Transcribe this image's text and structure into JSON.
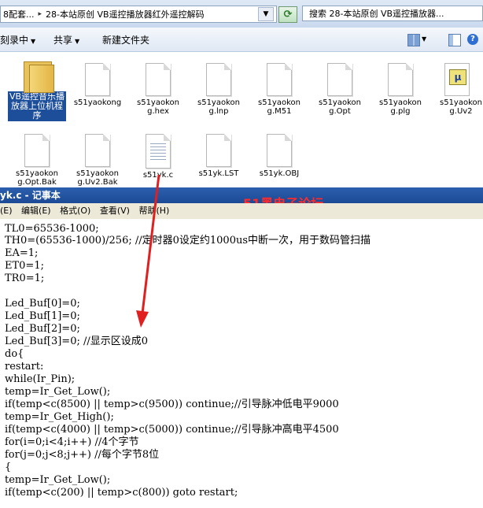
{
  "address_bar": {
    "crumbs": [
      "8配套...",
      "28-本站原创 VB遥控播放器红外遥控解码"
    ],
    "dropdown_icon": "chevron-down-icon",
    "refresh_icon": "refresh-icon",
    "search_text": "搜索 28-本站原创 VB遥控播放器..."
  },
  "toolbar": {
    "items": [
      "刻录中",
      "共享",
      "新建文件夹"
    ]
  },
  "files": [
    {
      "name": "VB遥控音乐播放器上位机程序",
      "type": "folder",
      "selected": true
    },
    {
      "name": "s51yaokong",
      "type": "file"
    },
    {
      "name": "s51yaokong.hex",
      "type": "file"
    },
    {
      "name": "s51yaokong.lnp",
      "type": "file"
    },
    {
      "name": "s51yaokong.M51",
      "type": "file"
    },
    {
      "name": "s51yaokong.Opt",
      "type": "file"
    },
    {
      "name": "s51yaokong.plg",
      "type": "file"
    },
    {
      "name": "s51yaokong.Uv2",
      "type": "uv2"
    },
    {
      "name": "s51yaokong.Opt.Bak",
      "type": "file"
    },
    {
      "name": "s51yaokong.Uv2.Bak",
      "type": "file"
    },
    {
      "name": "s51yk.c",
      "type": "text"
    },
    {
      "name": "s51yk.LST",
      "type": "file"
    },
    {
      "name": "s51yk.OBJ",
      "type": "file"
    }
  ],
  "notepad": {
    "title": "yk.c - 记事本",
    "menu": [
      "(E)",
      "编辑(E)",
      "格式(O)",
      "查看(V)",
      "帮助(H)"
    ],
    "watermark": "51黑电子论坛",
    "lines": [
      "TL0=65536-1000;",
      "TH0=(65536-1000)/256; //定时器0设定约1000us中断一次，用于数码管扫描",
      "EA=1;",
      "ET0=1;",
      "TR0=1;",
      "",
      "Led_Buf[0]=0;",
      "Led_Buf[1]=0;",
      "Led_Buf[2]=0;",
      "Led_Buf[3]=0; //显示区设成0",
      "do{",
      "restart:",
      "while(Ir_Pin);",
      "temp=Ir_Get_Low();",
      "if(temp<c(8500) || temp>c(9500)) continue;//引导脉冲低电平9000",
      "temp=Ir_Get_High();",
      "if(temp<c(4000) || temp>c(5000)) continue;//引导脉冲高电平4500",
      "for(i=0;i<4;i++) //4个字节",
      "for(j=0;j<8;j++) //每个字节8位",
      "{",
      "temp=Ir_Get_Low();",
      "if(temp<c(200) || temp>c(800)) goto restart;"
    ]
  },
  "colors": {
    "arrow": "#e02020",
    "title_bar": "#1c4a95",
    "watermark": "#ff2a2a"
  }
}
